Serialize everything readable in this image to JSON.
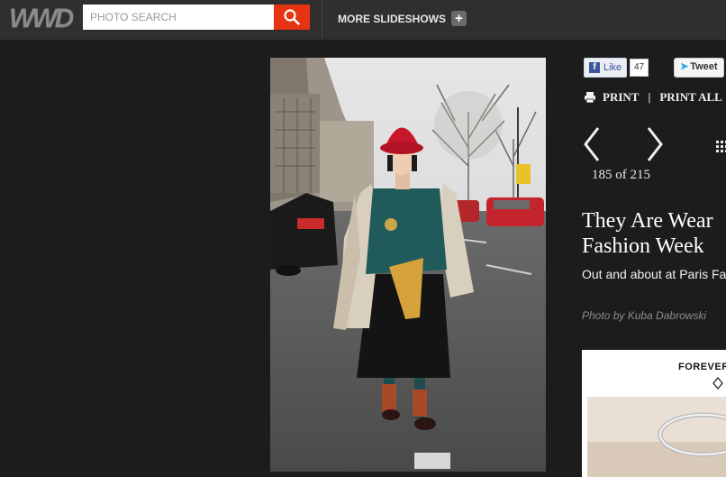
{
  "header": {
    "logo": "WWD",
    "search_placeholder": "PHOTO SEARCH",
    "more_slideshows": "MORE SLIDESHOWS"
  },
  "social": {
    "like_label": "Like",
    "like_count": "47",
    "tweet_label": "Tweet"
  },
  "print": {
    "print_label": "PRINT",
    "separator": "|",
    "print_all_label": "PRINT ALL"
  },
  "gallery": {
    "counter": "185 of 215",
    "title_line1": "They Are Wear",
    "title_line2": "Fashion Week",
    "subtitle": "Out and about at Paris Fa",
    "credit": "Photo by Kuba Dabrowski"
  },
  "ad": {
    "brand_text": "FOREVER"
  },
  "icons": {
    "search": "magnifier-icon",
    "plus": "plus-icon",
    "prev": "chevron-left-icon",
    "next": "chevron-right-icon",
    "grid": "grid-icon",
    "printer": "printer-icon"
  },
  "colors": {
    "background": "#1c1c1c",
    "topbar": "#2f2f2f",
    "search_button": "#e63312"
  }
}
